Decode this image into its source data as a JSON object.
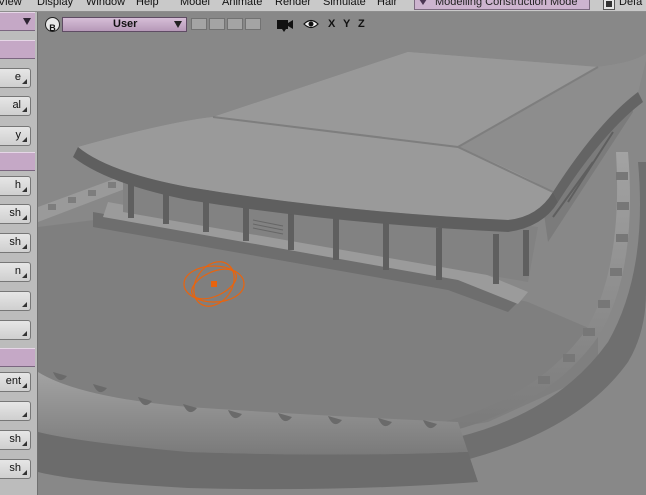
{
  "menubar": {
    "items": [
      "View",
      "Display",
      "Window",
      "Help",
      "Model",
      "Animate",
      "Render",
      "Simulate",
      "Hair"
    ],
    "mode_select": "Modelling Construction Mode",
    "defaults_label": "Defa"
  },
  "left_panel": {
    "buttons": [
      "e",
      "al",
      "y",
      "h",
      "sh",
      "sh",
      "n",
      "",
      "",
      "ent",
      "",
      "sh",
      "sh"
    ]
  },
  "viewport": {
    "badge": "B",
    "camera": "User",
    "axes": [
      "X",
      "Y",
      "Z"
    ]
  },
  "colors": {
    "panel_header": "#c5a8c6",
    "viewport_bg": "#898989",
    "null_object": "#e8640f"
  },
  "icons": [
    "camera-icon",
    "eye-icon",
    "triangle-down-icon"
  ]
}
